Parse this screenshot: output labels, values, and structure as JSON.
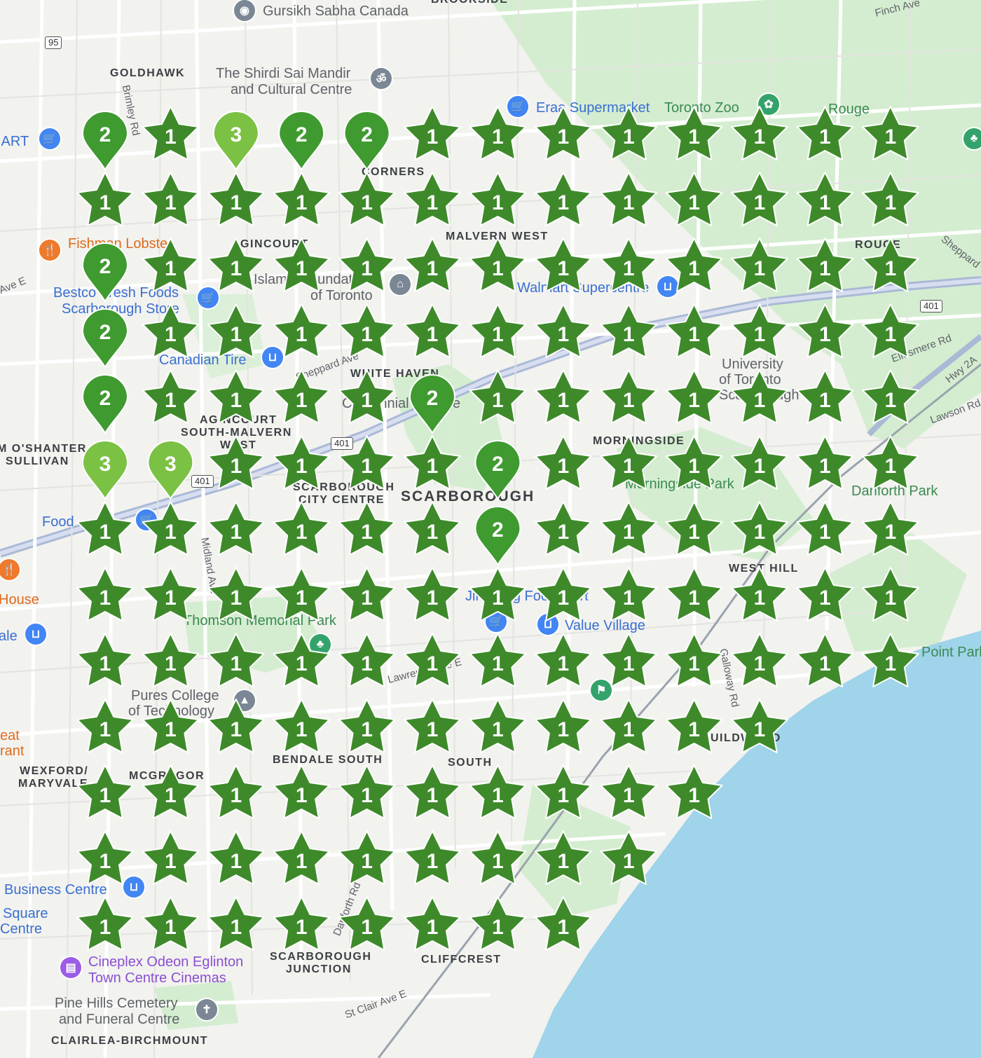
{
  "map": {
    "labels": [
      {
        "id": "gursikh",
        "text": "Gursikh Sabha Canada",
        "cls": "poi-grey"
      },
      {
        "id": "brookside",
        "text": "BROOKSIDE",
        "cls": "area"
      },
      {
        "id": "finch",
        "text": "Finch Ave",
        "cls": "road"
      },
      {
        "id": "goldhawk",
        "text": "GOLDHAWK",
        "cls": "area"
      },
      {
        "id": "shirdi1",
        "text": "The Shirdi Sai Mandir",
        "cls": "poi-grey"
      },
      {
        "id": "shirdi2",
        "text": "and Cultural Centre",
        "cls": "poi-grey"
      },
      {
        "id": "eraa",
        "text": "Eraa Supermarket",
        "cls": "poi"
      },
      {
        "id": "zoo",
        "text": "Toronto Zoo",
        "cls": "park"
      },
      {
        "id": "rouge1",
        "text": "Rouge",
        "cls": "park"
      },
      {
        "id": "brimley",
        "text": "Brimley Rd",
        "cls": "road"
      },
      {
        "id": "art",
        "text": "IART",
        "cls": "poi"
      },
      {
        "id": "towncorners",
        "text": "CORNERS",
        "cls": "area"
      },
      {
        "id": "malvernwest",
        "text": "MALVERN WEST",
        "cls": "area"
      },
      {
        "id": "rouge2",
        "text": "ROUGE",
        "cls": "area"
      },
      {
        "id": "sheppardR",
        "text": "Sheppard",
        "cls": "road"
      },
      {
        "id": "fishman",
        "text": "Fishman Lobster",
        "cls": "poi-orange"
      },
      {
        "id": "aveE",
        "text": "Ave E",
        "cls": "road"
      },
      {
        "id": "agincourt1",
        "text": "AGINCOURT",
        "cls": "area"
      },
      {
        "id": "bestco",
        "text": "Bestco Fresh Foods",
        "cls": "poi"
      },
      {
        "id": "scarstore",
        "text": "Scarborough Store",
        "cls": "poi"
      },
      {
        "id": "islamic",
        "text": "Islamic Foundation",
        "cls": "poi-grey"
      },
      {
        "id": "oftoronto",
        "text": "of Toronto",
        "cls": "poi-grey"
      },
      {
        "id": "walmart",
        "text": "Walmart Supercentre",
        "cls": "poi"
      },
      {
        "id": "canadiantire",
        "text": "Canadian Tire",
        "cls": "poi"
      },
      {
        "id": "sheppardAve",
        "text": "Sheppard Ave",
        "cls": "road"
      },
      {
        "id": "whitehaven",
        "text": "WHITE HAVEN",
        "cls": "area"
      },
      {
        "id": "centennial",
        "text": "Centennial College",
        "cls": "poi-grey"
      },
      {
        "id": "uoft1",
        "text": "University",
        "cls": "poi-grey"
      },
      {
        "id": "uoft2",
        "text": "of Toronto",
        "cls": "poi-grey"
      },
      {
        "id": "uoft3",
        "text": "Scarborough",
        "cls": "poi-grey"
      },
      {
        "id": "ellesmere",
        "text": "Ellesmere Rd",
        "cls": "road"
      },
      {
        "id": "hwy2a",
        "text": "Hwy 2A",
        "cls": "road"
      },
      {
        "id": "lawson",
        "text": "Lawson Rd",
        "cls": "road"
      },
      {
        "id": "agincourt2",
        "text": "AGINCOURT",
        "cls": "area"
      },
      {
        "id": "southmalvern",
        "text": "SOUTH-MALVERN",
        "cls": "area"
      },
      {
        "id": "west",
        "text": "WEST",
        "cls": "area"
      },
      {
        "id": "oshanter",
        "text": "M O'SHANTER",
        "cls": "area"
      },
      {
        "id": "sullivan",
        "text": "SULLIVAN",
        "cls": "area"
      },
      {
        "id": "morningside",
        "text": "MORNINGSIDE",
        "cls": "area"
      },
      {
        "id": "morningpark",
        "text": "Morningside Park",
        "cls": "park"
      },
      {
        "id": "danforthpark",
        "text": "Danforth Park",
        "cls": "park"
      },
      {
        "id": "scarcc1",
        "text": "SCARBOROUGH",
        "cls": "area"
      },
      {
        "id": "scarcc2",
        "text": "CITY CENTRE",
        "cls": "area"
      },
      {
        "id": "scarborough",
        "text": "SCARBOROUGH",
        "cls": "area"
      },
      {
        "id": "food",
        "text": "Food",
        "cls": "poi"
      },
      {
        "id": "westhill",
        "text": "WEST HILL",
        "cls": "area"
      },
      {
        "id": "house",
        "text": "House",
        "cls": "poi-orange"
      },
      {
        "id": "thomson",
        "text": "Thomson Memorial Park",
        "cls": "park"
      },
      {
        "id": "jinhong",
        "text": "Jin Hong Food Mart",
        "cls": "poi"
      },
      {
        "id": "valuevillage",
        "text": "Value Village",
        "cls": "poi"
      },
      {
        "id": "ale",
        "text": "ale",
        "cls": "poi"
      },
      {
        "id": "pointpark",
        "text": "Point Park",
        "cls": "park"
      },
      {
        "id": "lawrence",
        "text": "Lawrence Ave E",
        "cls": "road"
      },
      {
        "id": "pures1",
        "text": "Pures College",
        "cls": "poi-grey"
      },
      {
        "id": "pures2",
        "text": "of Technology",
        "cls": "poi-grey"
      },
      {
        "id": "eat",
        "text": "eat",
        "cls": "poi-orange"
      },
      {
        "id": "rant",
        "text": "rant",
        "cls": "poi-orange"
      },
      {
        "id": "guild",
        "text": "GUILDWOOD",
        "cls": "area"
      },
      {
        "id": "bendale",
        "text": "BENDALE SOUTH",
        "cls": "area"
      },
      {
        "id": "southeg",
        "text": "SOUTH",
        "cls": "area"
      },
      {
        "id": "wexford",
        "text": "WEXFORD/",
        "cls": "area"
      },
      {
        "id": "maryvale",
        "text": "MARYVALE",
        "cls": "area"
      },
      {
        "id": "mcgregor",
        "text": "MCGREGOR",
        "cls": "area"
      },
      {
        "id": "business",
        "text": "Business Centre",
        "cls": "poi"
      },
      {
        "id": "square",
        "text": "Square",
        "cls": "poi"
      },
      {
        "id": "centre",
        "text": "Centre",
        "cls": "poi"
      },
      {
        "id": "danforthrd",
        "text": "Danforth Rd",
        "cls": "road"
      },
      {
        "id": "scarjct1",
        "text": "SCARBOROUGH",
        "cls": "area"
      },
      {
        "id": "scarjct2",
        "text": "JUNCTION",
        "cls": "area"
      },
      {
        "id": "cliffcrest",
        "text": "CLIFFCREST",
        "cls": "area"
      },
      {
        "id": "cineplex1",
        "text": "Cineplex Odeon Eglinton",
        "cls": "poi-purple"
      },
      {
        "id": "cineplex2",
        "text": "Town Centre Cinemas",
        "cls": "poi-purple"
      },
      {
        "id": "pinehills1",
        "text": "Pine Hills Cemetery",
        "cls": "poi-grey"
      },
      {
        "id": "pinehills2",
        "text": "and Funeral Centre",
        "cls": "poi-grey"
      },
      {
        "id": "stclair",
        "text": "St Clair Ave E",
        "cls": "road"
      },
      {
        "id": "clairlea",
        "text": "CLAIRLEA-BIRCHMOUNT",
        "cls": "area"
      },
      {
        "id": "midland",
        "text": "Midland Ave",
        "cls": "road"
      },
      {
        "id": "galloway",
        "text": "Galloway Rd",
        "cls": "road"
      }
    ],
    "shields": [
      {
        "id": "s95",
        "text": "95"
      },
      {
        "id": "s401a",
        "text": "401"
      },
      {
        "id": "s401b",
        "text": "401"
      },
      {
        "id": "s401c",
        "text": "401"
      }
    ],
    "pin_icons": [
      {
        "id": "shirdi-pin",
        "icon": "temple-icon",
        "color": "grey"
      },
      {
        "id": "gursikh-pin",
        "icon": "worship-icon",
        "color": "grey"
      },
      {
        "id": "eraa-pin",
        "icon": "cart-icon",
        "color": "blue"
      },
      {
        "id": "zoo-pin",
        "icon": "paw-icon",
        "color": "green"
      },
      {
        "id": "art-pin",
        "icon": "cart-icon",
        "color": "blue"
      },
      {
        "id": "fishman-pin",
        "icon": "fork-knife-icon",
        "color": "orange"
      },
      {
        "id": "bestco-pin",
        "icon": "cart-icon",
        "color": "blue"
      },
      {
        "id": "islamic-pin",
        "icon": "museum-icon",
        "color": "grey"
      },
      {
        "id": "walmart-pin",
        "icon": "shopping-bag-icon",
        "color": "blue"
      },
      {
        "id": "canadiantire-pin",
        "icon": "shopping-bag-icon",
        "color": "blue"
      },
      {
        "id": "food-pin",
        "icon": "cart-icon",
        "color": "blue"
      },
      {
        "id": "house-pin",
        "icon": "fork-knife-icon",
        "color": "orange"
      },
      {
        "id": "jinhong-pin",
        "icon": "cart-icon",
        "color": "blue"
      },
      {
        "id": "valuevillage-pin",
        "icon": "shopping-bag-icon",
        "color": "blue"
      },
      {
        "id": "ale-pin",
        "icon": "shopping-bag-icon",
        "color": "blue"
      },
      {
        "id": "pures-pin",
        "icon": "school-icon",
        "color": "grey"
      },
      {
        "id": "business-pin",
        "icon": "shopping-bag-icon",
        "color": "blue"
      },
      {
        "id": "cineplex-pin",
        "icon": "film-icon",
        "color": "purple"
      },
      {
        "id": "pinehills-pin",
        "icon": "cemetery-icon",
        "color": "grey"
      },
      {
        "id": "golf-pin",
        "icon": "golf-icon",
        "color": "green"
      },
      {
        "id": "rouge-pin",
        "icon": "tree-icon",
        "color": "green"
      },
      {
        "id": "thomson-pin",
        "icon": "tree-icon",
        "color": "green"
      }
    ],
    "colors": {
      "land": "#f2f2ef",
      "park": "#cdeacb",
      "water": "#9fd4ea",
      "highway": "#8fa3c7",
      "star_fill": "#3e8a2a",
      "pin_fill_dark": "#3f9a30",
      "pin_fill_light": "#7bc144"
    },
    "markers": {
      "columns": 13,
      "rows": 13,
      "grid": [
        [
          "p2",
          "s1",
          "P3",
          "p2",
          "p2",
          "s1",
          "s1",
          "s1",
          "s1",
          "s1",
          "s1",
          "s1",
          "s1"
        ],
        [
          "s1",
          "s1",
          "s1",
          "s1",
          "s1",
          "s1",
          "s1",
          "s1",
          "s1",
          "s1",
          "s1",
          "s1",
          "s1"
        ],
        [
          "p2",
          "s1",
          "s1",
          "s1",
          "s1",
          "s1",
          "s1",
          "s1",
          "s1",
          "s1",
          "s1",
          "s1",
          "s1"
        ],
        [
          "p2",
          "s1",
          "s1",
          "s1",
          "s1",
          "s1",
          "s1",
          "s1",
          "s1",
          "s1",
          "s1",
          "s1",
          "s1"
        ],
        [
          "p2",
          "s1",
          "s1",
          "s1",
          "s1",
          "p2",
          "s1",
          "s1",
          "s1",
          "s1",
          "s1",
          "s1",
          "s1"
        ],
        [
          "P3",
          "P3",
          "s1",
          "s1",
          "s1",
          "s1",
          "p2",
          "s1",
          "s1",
          "s1",
          "s1",
          "s1",
          "s1"
        ],
        [
          "s1",
          "s1",
          "s1",
          "s1",
          "s1",
          "s1",
          "p2",
          "s1",
          "s1",
          "s1",
          "s1",
          "s1",
          "s1"
        ],
        [
          "s1",
          "s1",
          "s1",
          "s1",
          "s1",
          "s1",
          "s1",
          "s1",
          "s1",
          "s1",
          "s1",
          "s1",
          "s1"
        ],
        [
          "s1",
          "s1",
          "s1",
          "s1",
          "s1",
          "s1",
          "s1",
          "s1",
          "s1",
          "s1",
          "s1",
          "s1",
          "s1"
        ],
        [
          "s1",
          "s1",
          "s1",
          "s1",
          "s1",
          "s1",
          "s1",
          "s1",
          "s1",
          "s1",
          "s1",
          "",
          ""
        ],
        [
          "s1",
          "s1",
          "s1",
          "s1",
          "s1",
          "s1",
          "s1",
          "s1",
          "s1",
          "s1",
          "",
          "",
          ""
        ],
        [
          "s1",
          "s1",
          "s1",
          "s1",
          "s1",
          "s1",
          "s1",
          "s1",
          "s1",
          "",
          "",
          "",
          ""
        ],
        [
          "s1",
          "s1",
          "s1",
          "s1",
          "s1",
          "s1",
          "s1",
          "s1",
          "",
          "",
          "",
          "",
          ""
        ]
      ]
    }
  }
}
